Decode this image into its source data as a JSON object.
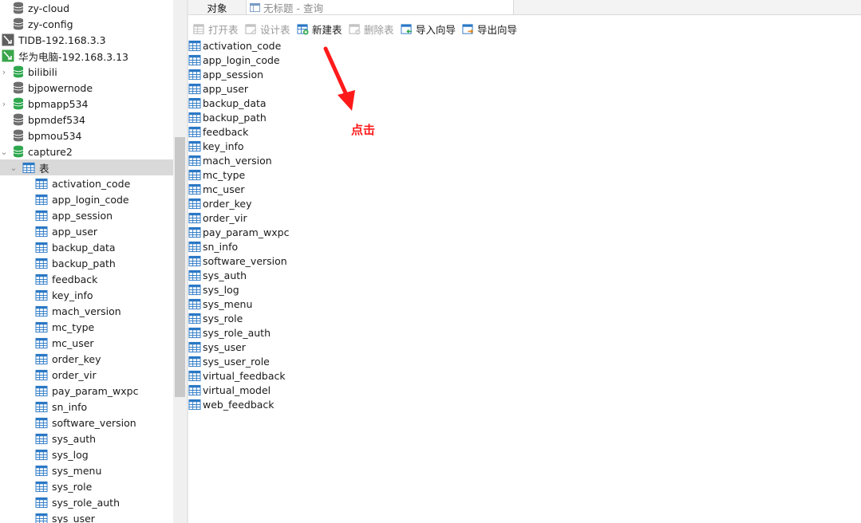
{
  "tree": {
    "connections_top": [
      {
        "label": "zy-cloud",
        "icon": "database-gray-icon",
        "expandable": false
      },
      {
        "label": "zy-config",
        "icon": "database-gray-icon",
        "expandable": false
      }
    ],
    "servers": [
      {
        "label": "TIDB-192.168.3.3",
        "icon": "server-connection-icon"
      },
      {
        "label": "华为电脑-192.168.3.13",
        "icon": "server-connection-green-icon"
      }
    ],
    "databases": [
      {
        "label": "bilibili",
        "icon": "database-green-icon",
        "expandable": true
      },
      {
        "label": "bjpowernode",
        "icon": "database-gray-icon",
        "expandable": false
      },
      {
        "label": "bpmapp534",
        "icon": "database-green-icon",
        "expandable": true
      },
      {
        "label": "bpmdef534",
        "icon": "database-gray-icon",
        "expandable": false
      },
      {
        "label": "bpmou534",
        "icon": "database-gray-icon",
        "expandable": false
      },
      {
        "label": "capture2",
        "icon": "database-green-icon",
        "expandable": true,
        "expanded": true
      }
    ],
    "tables_node_label": "表",
    "tables": [
      "activation_code",
      "app_login_code",
      "app_session",
      "app_user",
      "backup_data",
      "backup_path",
      "feedback",
      "key_info",
      "mach_version",
      "mc_type",
      "mc_user",
      "order_key",
      "order_vir",
      "pay_param_wxpc",
      "sn_info",
      "software_version",
      "sys_auth",
      "sys_log",
      "sys_menu",
      "sys_role",
      "sys_role_auth",
      "sys_user"
    ]
  },
  "tabs": {
    "objects": "对象",
    "query": "无标题 - 查询"
  },
  "toolbar": {
    "open_table": "打开表",
    "design_table": "设计表",
    "new_table": "新建表",
    "delete_table": "删除表",
    "import_wizard": "导入向导",
    "export_wizard": "导出向导"
  },
  "objects": [
    "activation_code",
    "app_login_code",
    "app_session",
    "app_user",
    "backup_data",
    "backup_path",
    "feedback",
    "key_info",
    "mach_version",
    "mc_type",
    "mc_user",
    "order_key",
    "order_vir",
    "pay_param_wxpc",
    "sn_info",
    "software_version",
    "sys_auth",
    "sys_log",
    "sys_menu",
    "sys_role",
    "sys_role_auth",
    "sys_user",
    "sys_user_role",
    "virtual_feedback",
    "virtual_model",
    "web_feedback"
  ],
  "annotation": {
    "text": "点击",
    "color": "#ff1a1a"
  },
  "colors": {
    "db_green": "#2fa84f",
    "db_gray": "#6e6e6e",
    "table_blue": "#2b78c5",
    "selected_row": "#d9d9d9"
  }
}
